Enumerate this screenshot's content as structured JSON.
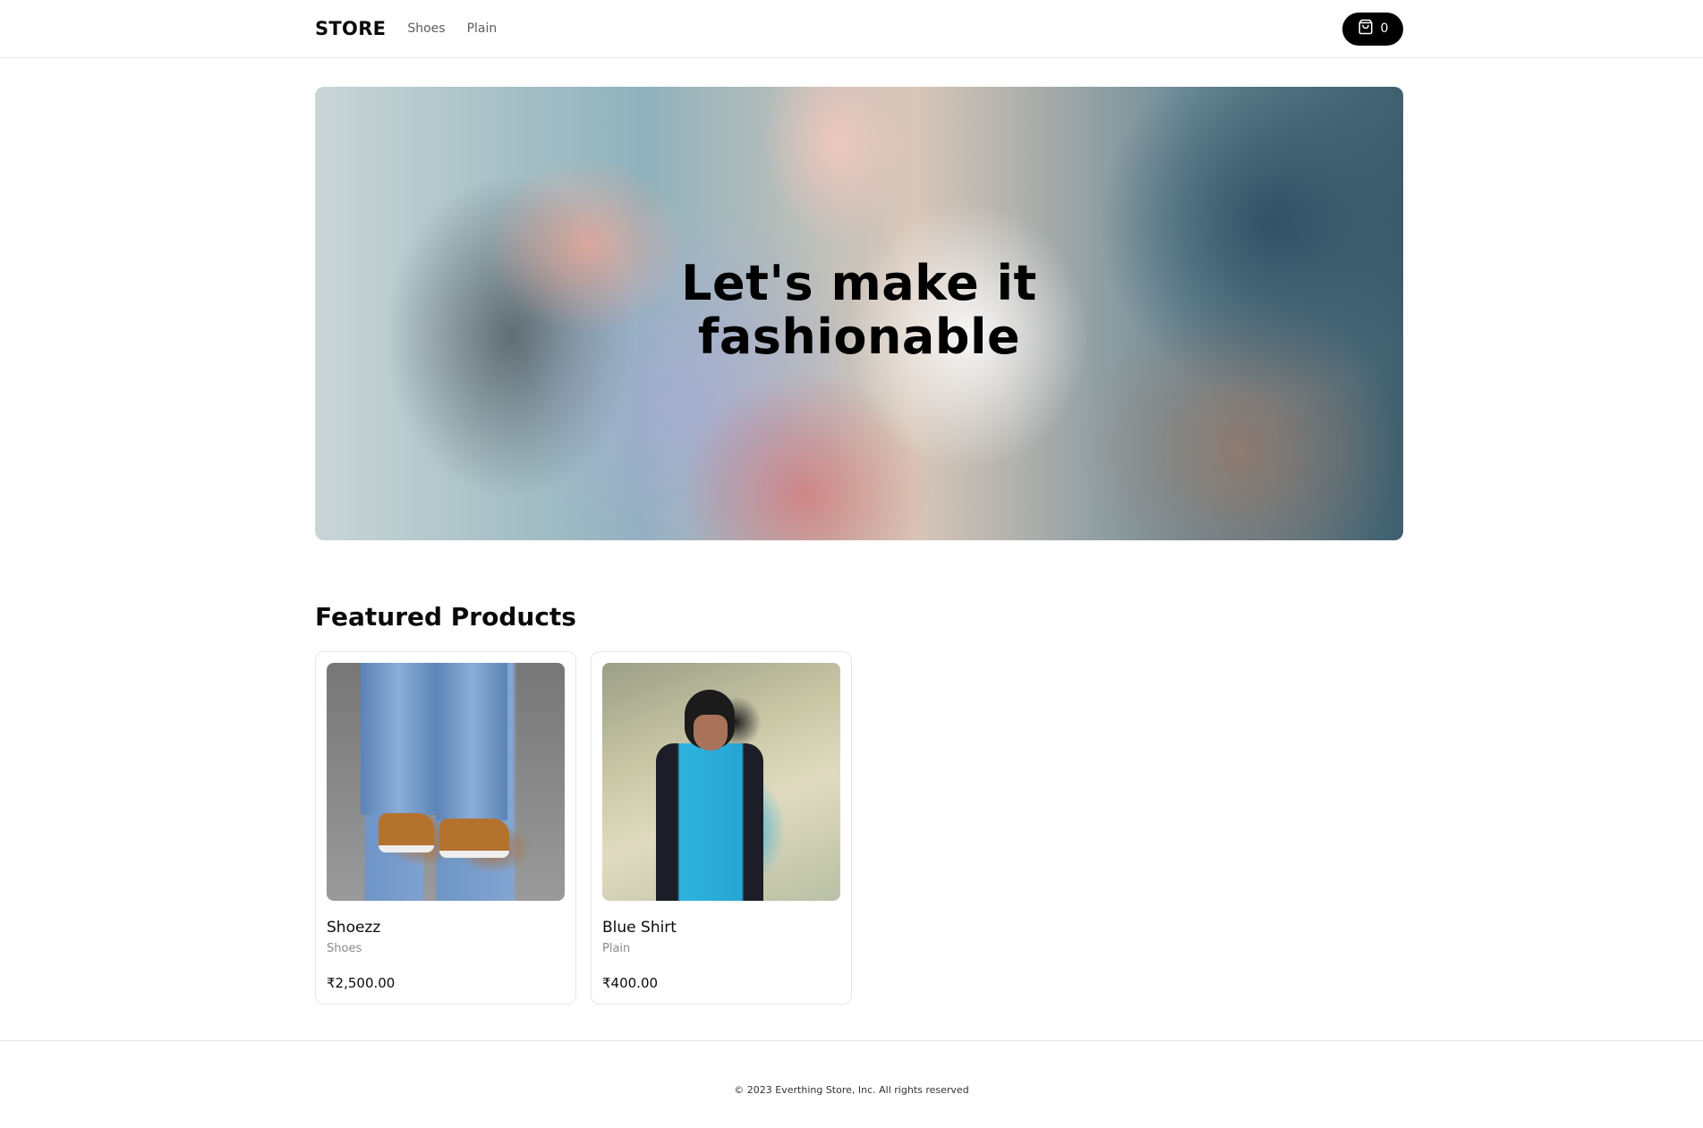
{
  "nav": {
    "logo": "STORE",
    "links": [
      "Shoes",
      "Plain"
    ],
    "cart_count": "0"
  },
  "hero": {
    "title_line1": "Let's make it",
    "title_line2": "fashionable"
  },
  "featured": {
    "title": "Featured Products",
    "products": [
      {
        "name": "Shoezz",
        "category": "Shoes",
        "price": "₹2,500.00"
      },
      {
        "name": "Blue Shirt",
        "category": "Plain",
        "price": "₹400.00"
      }
    ]
  },
  "footer": {
    "copyright": "© 2023 Everthing Store, Inc. All rights reserved"
  },
  "icons": {
    "cart": "shopping-bag-icon"
  }
}
